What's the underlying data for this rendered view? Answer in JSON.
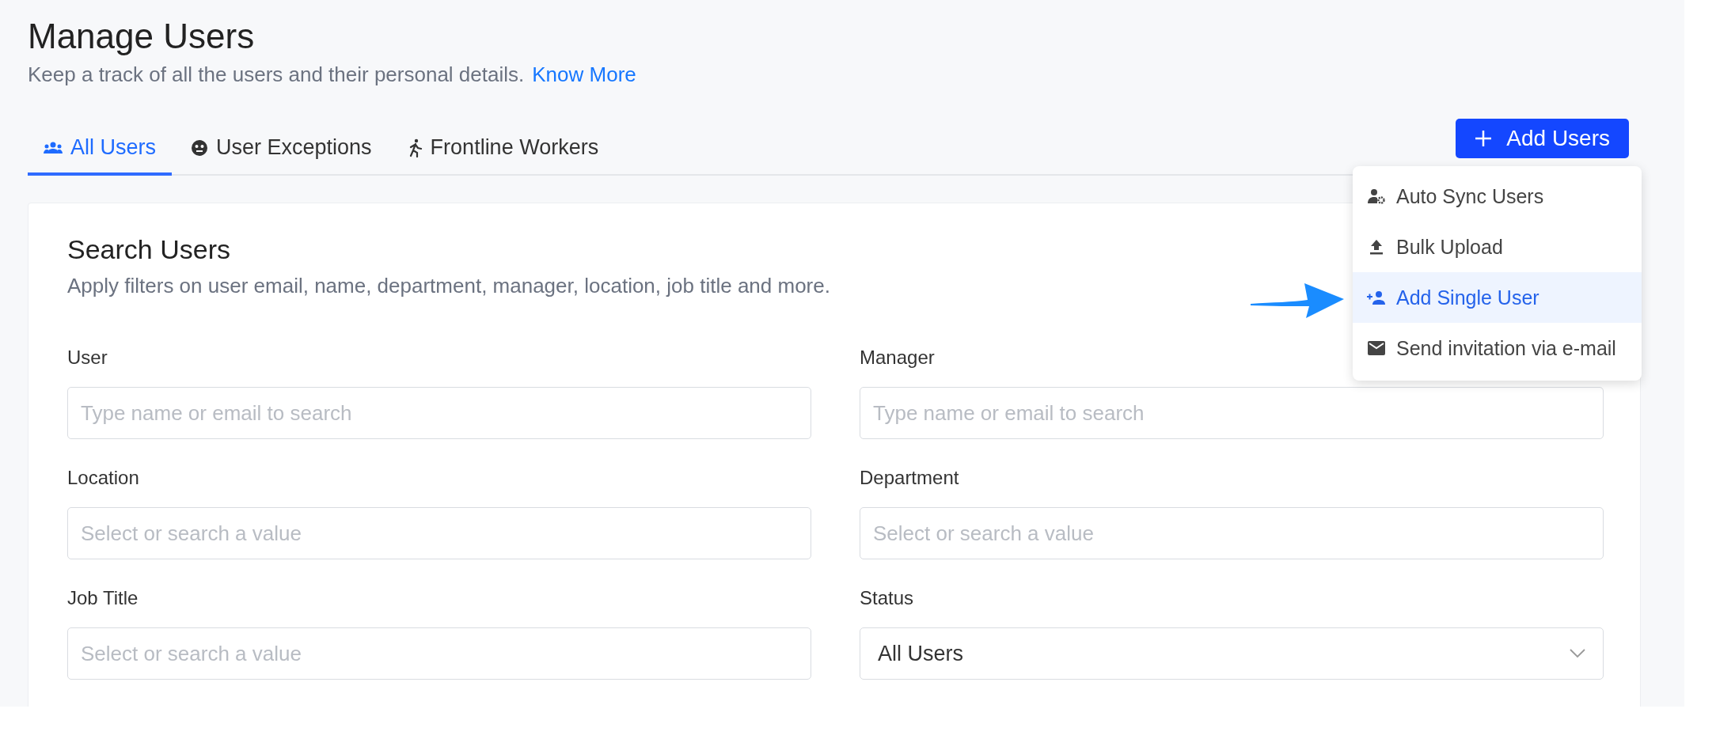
{
  "header": {
    "title": "Manage Users",
    "subtitle": "Keep a track of all the users and their personal details.",
    "link": "Know More"
  },
  "tabs": [
    {
      "label": "All Users",
      "selected": true
    },
    {
      "label": "User Exceptions",
      "selected": false
    },
    {
      "label": "Frontline Workers",
      "selected": false
    }
  ],
  "add_button": {
    "label": "Add Users"
  },
  "menu": {
    "items": [
      {
        "label": "Auto Sync Users",
        "selected": false
      },
      {
        "label": "Bulk Upload",
        "selected": false
      },
      {
        "label": "Add Single User",
        "selected": true
      },
      {
        "label": "Send invitation via e-mail",
        "selected": false
      }
    ]
  },
  "search": {
    "title": "Search Users",
    "description": "Apply filters on user email, name, department, manager, location, job title and more.",
    "fields": [
      {
        "label": "User",
        "kind": "input",
        "placeholder": "Type name or email to search"
      },
      {
        "label": "Manager",
        "kind": "input",
        "placeholder": "Type name or email to search"
      },
      {
        "label": "Location",
        "kind": "input",
        "placeholder": "Select or search a value"
      },
      {
        "label": "Department",
        "kind": "input",
        "placeholder": "Select or search a value"
      },
      {
        "label": "Job Title",
        "kind": "input",
        "placeholder": "Select or search a value"
      },
      {
        "label": "Status",
        "kind": "dropdown",
        "value": "All Users"
      }
    ]
  }
}
